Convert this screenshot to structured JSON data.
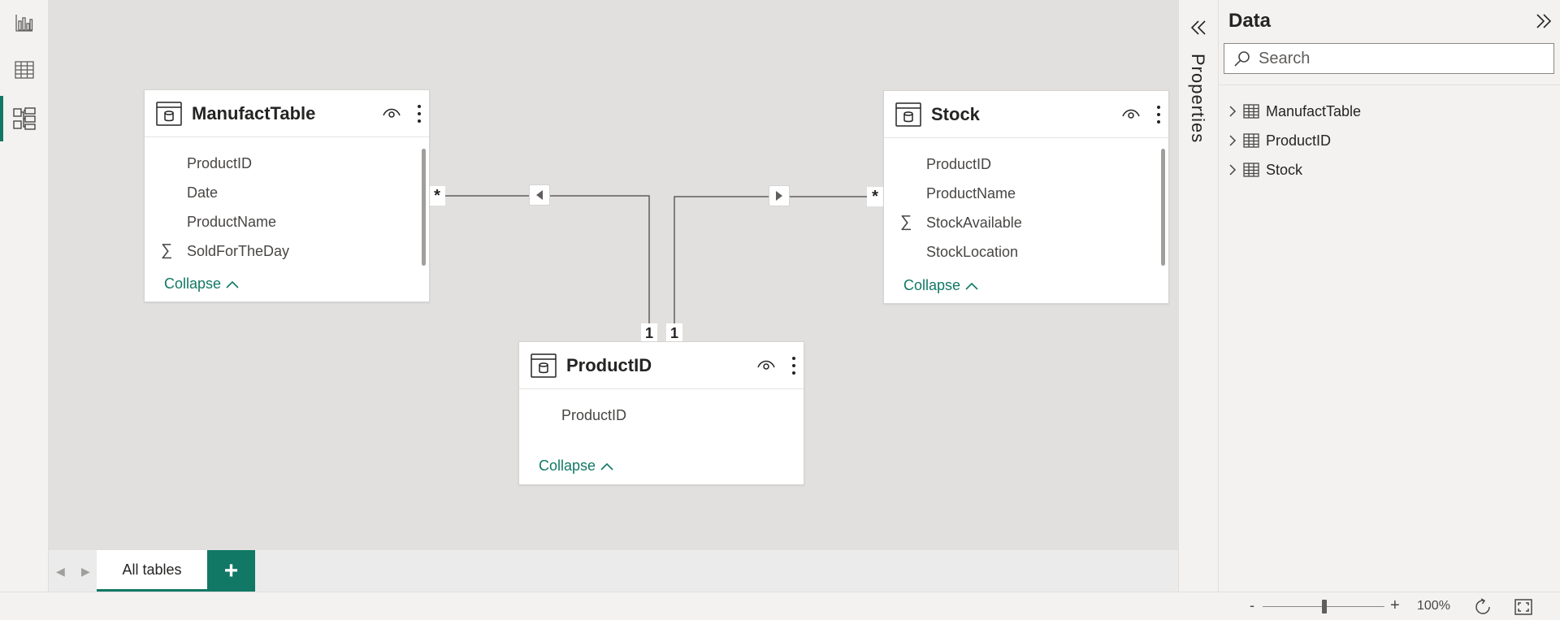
{
  "left_rail": {
    "items": [
      {
        "name": "report-view",
        "icon": "bar-chart-icon",
        "active": false
      },
      {
        "name": "table-view",
        "icon": "table-grid-icon",
        "active": false
      },
      {
        "name": "model-view",
        "icon": "model-diagram-icon",
        "active": true
      }
    ]
  },
  "tables": {
    "manufact": {
      "title": "ManufactTable",
      "fields": [
        "ProductID",
        "Date",
        "ProductName",
        "SoldForTheDay"
      ],
      "sigma_field": "SoldForTheDay",
      "collapse_label": "Collapse"
    },
    "stock": {
      "title": "Stock",
      "fields": [
        "ProductID",
        "ProductName",
        "StockAvailable",
        "StockLocation"
      ],
      "sigma_field": "StockAvailable",
      "collapse_label": "Collapse"
    },
    "productid": {
      "title": "ProductID",
      "fields": [
        "ProductID"
      ],
      "collapse_label": "Collapse"
    }
  },
  "relationships": {
    "left_many": "*",
    "right_many": "*",
    "left_one": "1",
    "right_one": "1"
  },
  "tabs": {
    "all_tables": "All tables",
    "add_label": "+"
  },
  "properties": {
    "label": "Properties"
  },
  "data_pane": {
    "title": "Data",
    "search_placeholder": "Search",
    "items": [
      "ManufactTable",
      "ProductID",
      "Stock"
    ]
  },
  "status": {
    "zoom_minus": "-",
    "zoom_plus": "+",
    "zoom_level": "100%",
    "zoom_fraction": 0.5
  },
  "colors": {
    "accent": "#117865",
    "canvas": "#e1e0df",
    "card": "#ffffff"
  }
}
